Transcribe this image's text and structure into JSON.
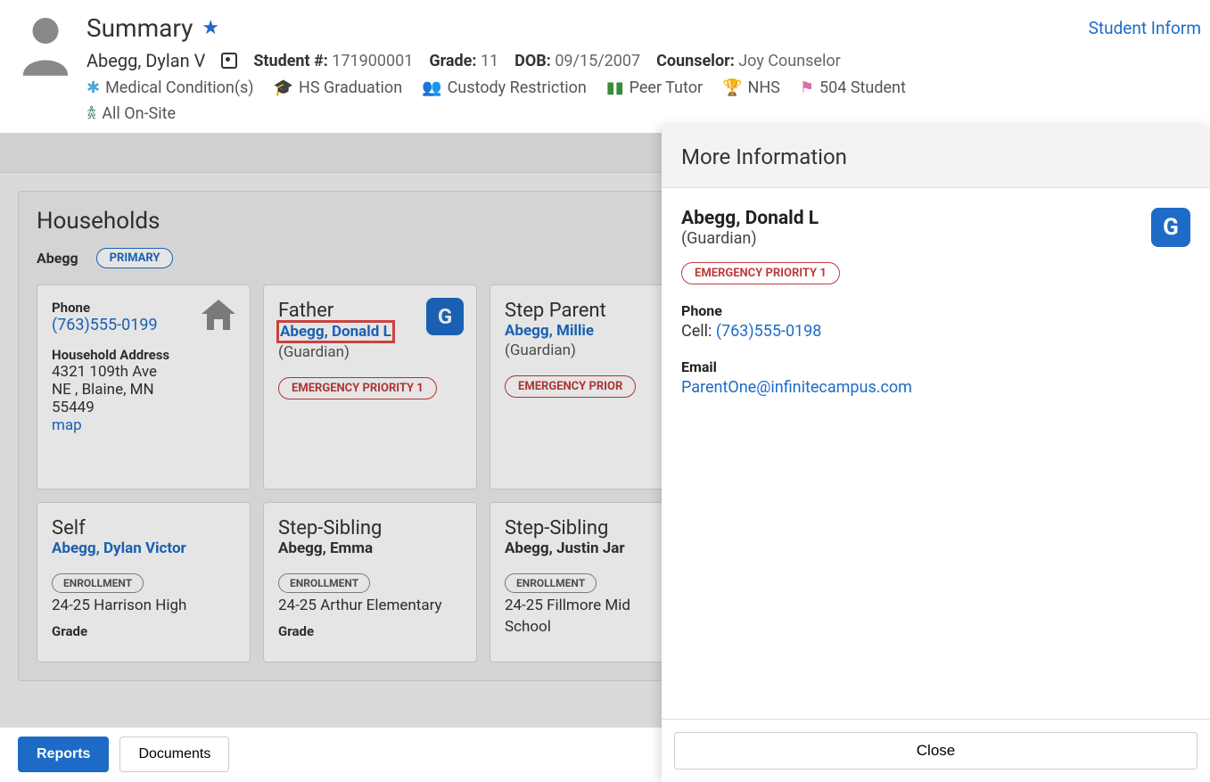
{
  "header": {
    "title": "Summary",
    "right_link": "Student Inform",
    "student_name": "Abegg, Dylan V",
    "info": {
      "student_number_label": "Student #:",
      "student_number": "171900001",
      "grade_label": "Grade:",
      "grade": "11",
      "dob_label": "DOB:",
      "dob": "09/15/2007",
      "counselor_label": "Counselor:",
      "counselor": "Joy Counselor"
    },
    "tags": {
      "medical": "Medical Condition(s)",
      "hs_grad": "HS Graduation",
      "custody": "Custody Restriction",
      "peer_tutor": "Peer Tutor",
      "nhs": "NHS",
      "plan504": "504 Student",
      "onsite": "All On-Site"
    }
  },
  "households": {
    "title": "Households",
    "tab_name": "Abegg",
    "primary_pill": "PRIMARY",
    "phone_card": {
      "phone_label": "Phone",
      "phone": "(763)555-0199",
      "address_label": "Household Address",
      "addr1": "4321 109th Ave",
      "addr2": "NE , Blaine, MN",
      "addr3": "55449",
      "map": "map"
    },
    "father": {
      "title": "Father",
      "name": "Abegg, Donald L",
      "role": "(Guardian)",
      "badge": "G",
      "emergency": "EMERGENCY PRIORITY 1"
    },
    "step_parent": {
      "title": "Step Parent",
      "name": "Abegg, Millie",
      "role": "(Guardian)",
      "emergency": "EMERGENCY PRIOR"
    },
    "self": {
      "title": "Self",
      "name": "Abegg, Dylan Victor",
      "enroll_pill": "ENROLLMENT",
      "enroll": "24-25 Harrison High",
      "grade_label": "Grade"
    },
    "step_sib1": {
      "title": "Step-Sibling",
      "name": "Abegg, Emma",
      "enroll_pill": "ENROLLMENT",
      "enroll": "24-25 Arthur Elementary",
      "grade_label": "Grade"
    },
    "step_sib2": {
      "title": "Step-Sibling",
      "name": "Abegg, Justin Jar",
      "enroll_pill": "ENROLLMENT",
      "enroll": "24-25 Fillmore Mid",
      "enroll2": "School"
    }
  },
  "bottom_tabs": {
    "reports": "Reports",
    "documents": "Documents"
  },
  "side_panel": {
    "header": "More Information",
    "name": "Abegg, Donald L",
    "role": "(Guardian)",
    "badge": "G",
    "emergency": "EMERGENCY PRIORITY 1",
    "phone_label": "Phone",
    "phone_type": "Cell: ",
    "phone": "(763)555-0198",
    "email_label": "Email",
    "email": "ParentOne@infinitecampus.com",
    "close": "Close"
  }
}
